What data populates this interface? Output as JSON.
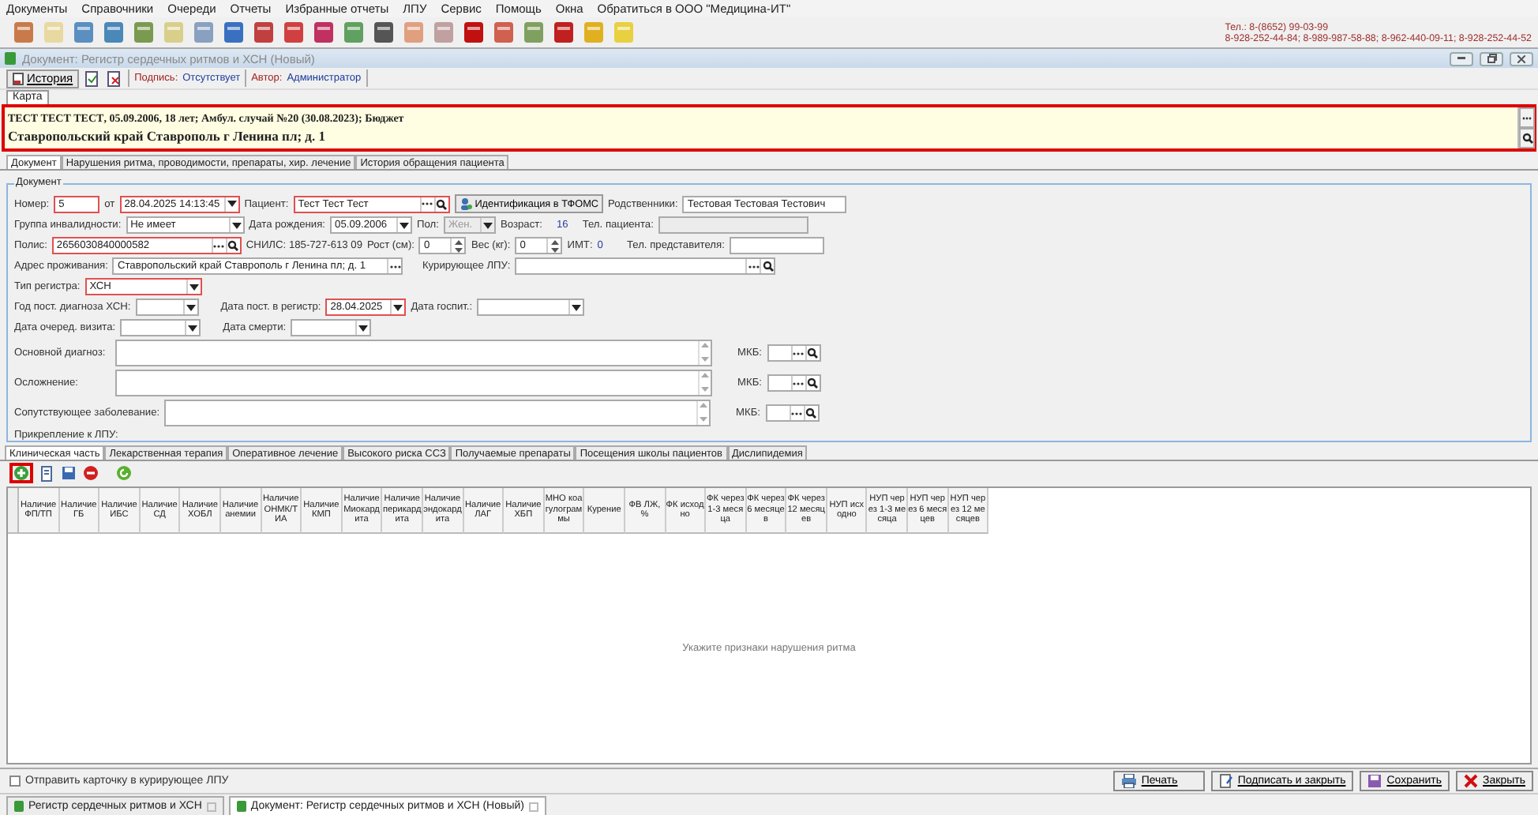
{
  "menu": [
    "Документы",
    "Справочники",
    "Очереди",
    "Отчеты",
    "Избранные отчеты",
    "ЛПУ",
    "Сервис",
    "Помощь",
    "Окна",
    "Обратиться в ООО \"Медицина-ИТ\""
  ],
  "contact": {
    "line_1": "Тел.: 8-(8652) 99-03-99",
    "line_2": "8-928-252-44-84; 8-989-987-58-88; 8-962-440-09-11; 8-928-252-44-52"
  },
  "window": {
    "title": "Документ: Регистр сердечных ритмов и ХСН (Новый)"
  },
  "doc_toolbar": {
    "history_button": "История",
    "signature_label": "Подпись:",
    "signature_value": "Отсутствует",
    "author_label": "Автор:",
    "author_value": "Администратор"
  },
  "card_tab": "Карта",
  "patient_banner": {
    "highlighted": true,
    "line_1": "**ТЕСТ ТЕСТ ТЕСТ**, 05.09.2006, 18 лет; Амбул. случай №20 (30.08.2023); Бюджет",
    "line_2": "Ставропольский край Ставрополь г Ленина пл; д. 1"
  },
  "tabs": [
    {
      "label": "Документ",
      "selected": true
    },
    {
      "label": "Нарушения ритма, проводимости, препараты, хир. лечение",
      "selected": false
    },
    {
      "label": "История обращения пациента",
      "selected": false
    }
  ],
  "document_form": {
    "legend": "Документ",
    "number": {
      "label": "Номер:",
      "value": "5",
      "required": true
    },
    "date": {
      "label": "от",
      "value": "28.04.2025 14:13:45",
      "required": true
    },
    "patient": {
      "label": "Пациент:",
      "value": "Тест Тест Тест",
      "required": true
    },
    "identify_button": "Идентификация в ТФОМС",
    "relatives": {
      "label": "Родственники:",
      "value": "Тестовая Тестовая Тестович",
      "required": false
    },
    "disability": {
      "label": "Группа инвалидности:",
      "value": "Не имеет",
      "required": false
    },
    "birth_date": {
      "label": "Дата рождения:",
      "value": "05.09.2006",
      "required": false
    },
    "sex": {
      "label": "Пол:",
      "value": "Жен.",
      "required": false,
      "disabled": true
    },
    "age": {
      "label": "Возраст:",
      "value": "16"
    },
    "patient_phone": {
      "label": "Тел. пациента:",
      "required": false,
      "disabled": true
    },
    "policy": {
      "label": "Полис:",
      "value": "2656030840000582",
      "required": true
    },
    "snils": "СНИЛС: 185-727-613 09",
    "height": {
      "label": "Рост (см):",
      "value": "0",
      "required": false
    },
    "weight": {
      "label": "Вес (кг):",
      "value": "0",
      "required": false
    },
    "bmi": {
      "label": "ИМТ:",
      "value": "0"
    },
    "representative_phone": {
      "label": "Тел. представителя:",
      "required": false
    },
    "address": {
      "label": "Адрес проживания:",
      "value": "Ставропольский край Ставрополь г Ленина пл; д. 1",
      "required": false
    },
    "supervising_lpu": {
      "label": "Курирующее ЛПУ:",
      "required": false
    },
    "register_type": {
      "label": "Тип регистра:",
      "value": "ХСН",
      "required": true
    },
    "diagnosis_year": {
      "label": "Год пост. диагноза ХСН:",
      "required": false
    },
    "register_date": {
      "label": "Дата пост. в регистр:",
      "value": "28.04.2025",
      "required": true
    },
    "hospital_date": {
      "label": "Дата госпит.:",
      "required": false
    },
    "next_visit": {
      "label": "Дата очеред. визита:",
      "required": false
    },
    "death_date": {
      "label": "Дата смерти:",
      "required": false
    },
    "diagnoses": [
      {
        "label": "Основной диагноз:",
        "mkb_label": "МКБ:"
      },
      {
        "label": "Осложнение:",
        "mkb_label": "МКБ:"
      },
      {
        "label": "Сопутствующее заболевание:",
        "mkb_label": "МКБ:"
      }
    ],
    "attachment_label": "Прикрепление к ЛПУ:"
  },
  "sub_tabs": [
    {
      "label": "Клиническая часть",
      "selected": true
    },
    {
      "label": "Лекарственная терапия",
      "selected": false
    },
    {
      "label": "Оперативное лечение",
      "selected": false
    },
    {
      "label": "Высокого риска ССЗ",
      "selected": false
    },
    {
      "label": "Получаемые препараты",
      "selected": false
    },
    {
      "label": "Посещения школы пациентов",
      "selected": false
    },
    {
      "label": "Дислипидемия",
      "selected": false
    }
  ],
  "grid_toolbar": {
    "add_highlighted": true
  },
  "table": {
    "columns": [
      "Наличие ФП/ТП",
      "Наличие ГБ",
      "Наличие ИБС",
      "Наличие СД",
      "Наличие ХОБЛ",
      "Наличие анемии",
      "Наличие ОНМК/ТИА",
      "Наличие КМП",
      "Наличие Миокардита",
      "Наличие перикардита",
      "Наличие эндокардита",
      "Наличие ЛАГ",
      "Наличие ХБП",
      "МНО коагулограммы",
      "Курение",
      "ФВ ЛЖ, %",
      "ФК исходно",
      "ФК через 1-3 месяца",
      "ФК через 6 месяцев",
      "ФК через 12 месяцев",
      "НУП исходно",
      "НУП через 1-3 месяца",
      "НУП через 6 месяцев",
      "НУП через 12 месяцев"
    ],
    "empty_message": "Укажите признаки нарушения ритма"
  },
  "footer": {
    "send_card": {
      "label": "Отправить карточку в курирующее ЛПУ",
      "checked": false
    },
    "buttons": [
      {
        "kind": "print",
        "label": "Печать"
      },
      {
        "kind": "sign",
        "label": "Подписать и закрыть"
      },
      {
        "kind": "save",
        "label": "Сохранить"
      },
      {
        "kind": "close",
        "label": "Закрыть"
      }
    ]
  },
  "taskbar": [
    {
      "label": "Регистр сердечных ритмов и ХСН",
      "selected": false
    },
    {
      "label": "Документ: Регистр сердечных ритмов и ХСН (Новый)",
      "selected": true
    }
  ]
}
